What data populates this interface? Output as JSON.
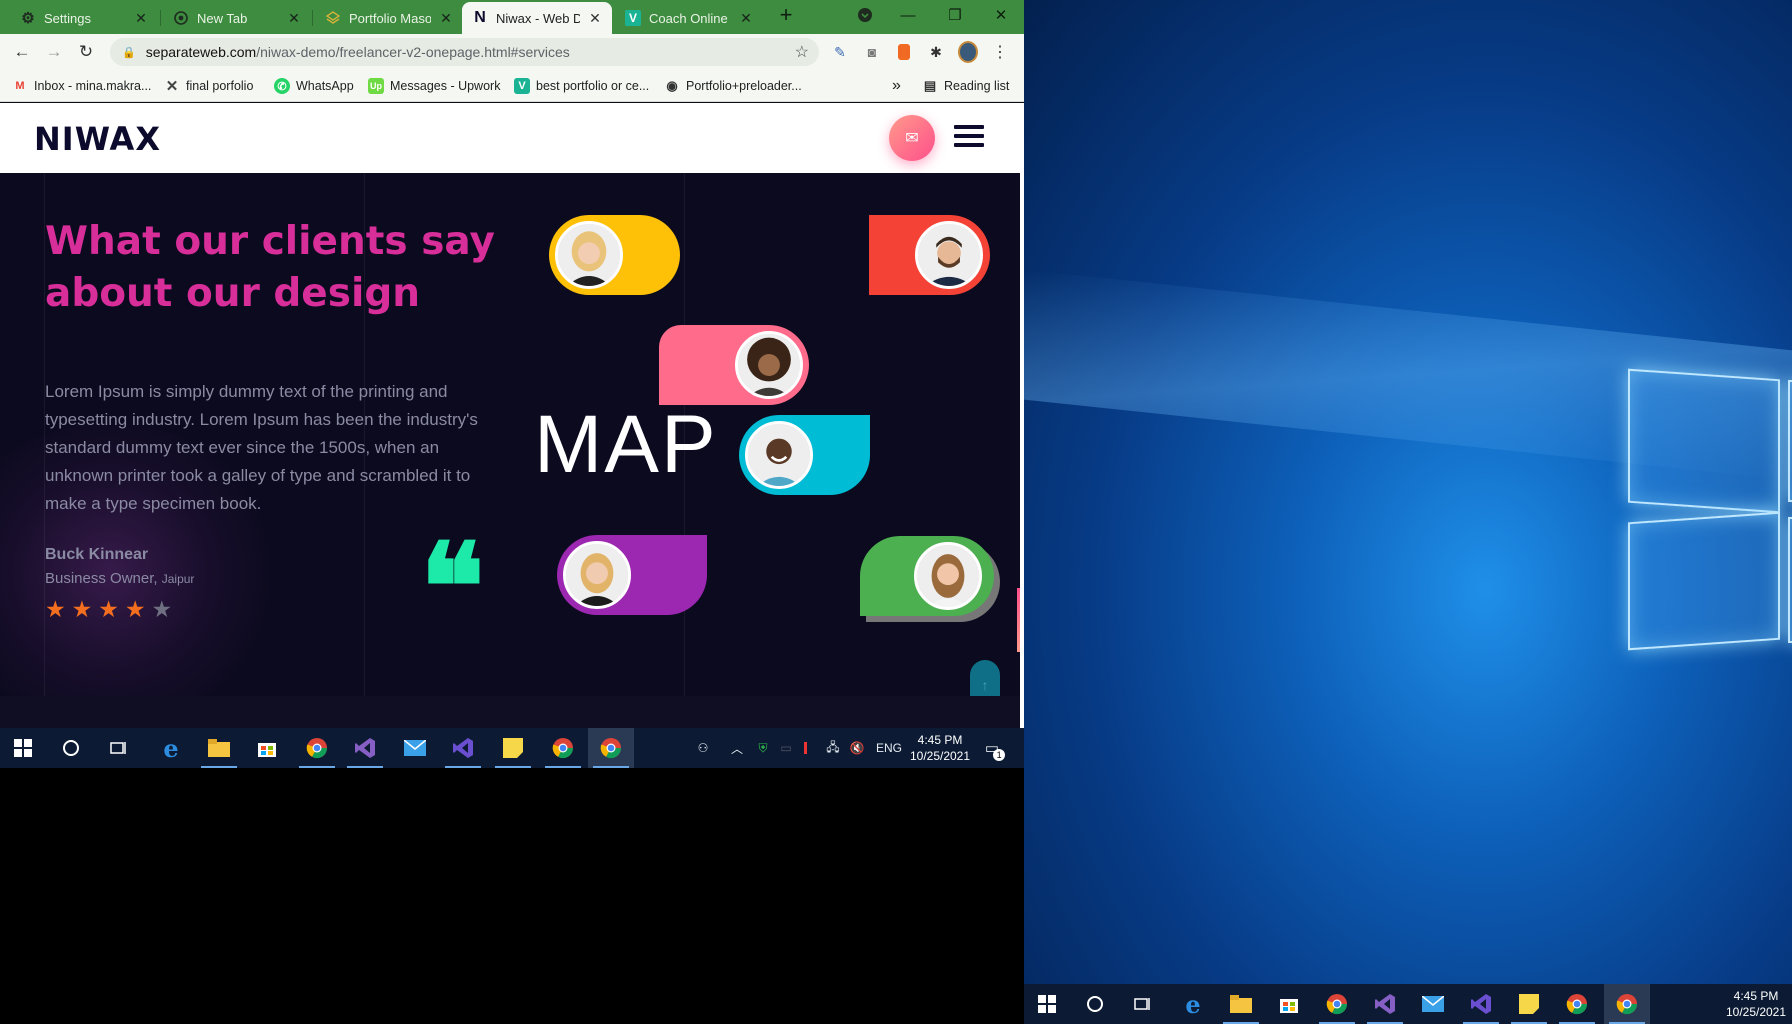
{
  "browser": {
    "tabs": [
      {
        "title": "Settings",
        "icon": "gear-icon"
      },
      {
        "title": "New Tab",
        "icon": "chrome-icon"
      },
      {
        "title": "Portfolio Mason",
        "icon": "layers-icon"
      },
      {
        "title": "Niwax - Web De",
        "icon": "niwax-n-icon"
      },
      {
        "title": "Coach Online Co",
        "icon": "v-icon"
      }
    ],
    "url_host": "separateweb.com",
    "url_path": "/niwax-demo/freelancer-v2-onepage.html#services",
    "bookmarks": [
      {
        "label": "Inbox - mina.makra...",
        "icon": "gmail-icon"
      },
      {
        "label": "final porfolio",
        "icon": "x-icon"
      },
      {
        "label": "WhatsApp",
        "icon": "whatsapp-icon"
      },
      {
        "label": "Messages - Upwork",
        "icon": "upwork-icon"
      },
      {
        "label": "best portfolio or ce...",
        "icon": "v-icon"
      },
      {
        "label": "Portfolio+preloader...",
        "icon": "globe-icon"
      }
    ],
    "reading_list": "Reading list",
    "more_bookmarks": "»"
  },
  "site": {
    "logo": "NIWAX",
    "heading": "What our clients say about our design",
    "quote": "Lorem Ipsum is simply dummy text of the printing and typesetting industry. Lorem Ipsum has been the industry's standard dummy text ever since the 1500s, when an unknown printer took a galley of type and scrambled it to make a type specimen book.",
    "author": "Buck Kinnear",
    "role": "Business Owner,",
    "location": "Jaipur",
    "rating": 4,
    "rating_max": 5,
    "map_label": "MAP",
    "quote_mark": "❝",
    "colors": {
      "heading": "#d72e9a",
      "star_on": "#f46e1f",
      "quote_mark": "#1de9a8",
      "pill_yellow": "#ffc107",
      "pill_red": "#f44336",
      "pill_pink": "#ff6b8b",
      "pill_cyan": "#00bcd4",
      "pill_purple": "#9c27b0",
      "pill_green": "#4caf50"
    }
  },
  "taskbar": {
    "lang": "ENG",
    "time": "4:45 PM",
    "date": "10/25/2021",
    "notifications": "1"
  },
  "desktop_taskbar": {
    "time": "4:45 PM",
    "date": "10/25/2021"
  }
}
